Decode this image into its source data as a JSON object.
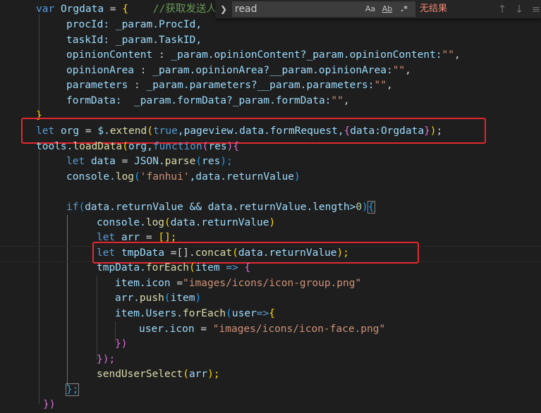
{
  "find": {
    "query": "read",
    "result": "无结果",
    "options": {
      "match_case": "Aa",
      "whole_word": "Ab",
      "regex": ".*"
    }
  },
  "code": {
    "l1": [
      "var",
      "Orgdata",
      "=",
      "{",
      "//获取发送人"
    ],
    "l2": [
      "procId:",
      "_param.ProcId,"
    ],
    "l3": [
      "taskId:",
      "_param.TaskID,"
    ],
    "l4": [
      "opinionContent",
      ":",
      "_param.opinionContent?_param.opinionContent:",
      "\"\"",
      ","
    ],
    "l5": [
      "opinionArea",
      ":",
      "_param.opinionArea?__param.opinionArea:",
      "\"\"",
      ","
    ],
    "l6": [
      "parameters",
      ":",
      "_param.parameters?__param.parameters:",
      "\"\"",
      ","
    ],
    "l7": [
      "formData:",
      "_param.formData?_param.formData:",
      "\"\"",
      ","
    ],
    "l8": [
      "}"
    ],
    "l9": [
      "let",
      "org",
      "=",
      "$.",
      "extend",
      "(",
      "true",
      ",pageview.data.formRequest,",
      "{",
      "data:Orgdata",
      "}",
      ")",
      ";"
    ],
    "l10": [
      "tools.",
      "loadData",
      "(",
      "org,",
      "function",
      "(",
      "res",
      "){"
    ],
    "l11": [
      "let",
      "data",
      "=",
      "JSON.",
      "parse",
      "(",
      "res",
      ");"
    ],
    "l12": [
      "console.",
      "log",
      "(",
      "'fanhui'",
      ",data.returnValue",
      ")"
    ],
    "l13": [
      "if",
      "(",
      "data.returnValue && data.returnValue.length>",
      "0",
      ")",
      "{"
    ],
    "l14": [
      "console.",
      "log",
      "(",
      "data.returnValue",
      ")"
    ],
    "l15": [
      "let",
      "arr",
      "=",
      "[];"
    ],
    "l16": [
      "let",
      "tmpData",
      "=[].",
      "concat",
      "(",
      "data.returnValue",
      ");"
    ],
    "l17": [
      "tmpData.",
      "forEach",
      "(",
      "item",
      "=>",
      "{"
    ],
    "l18": [
      "item.icon",
      "=",
      "\"images/icons/icon-group.png\""
    ],
    "l19": [
      "arr.",
      "push",
      "(",
      "item",
      ")"
    ],
    "l20": [
      "item.Users.",
      "forEach",
      "(",
      "user",
      "=>",
      "{"
    ],
    "l21": [
      "user.icon",
      "=",
      "\"images/icons/icon-face.png\""
    ],
    "l22": [
      "})"
    ],
    "l23": [
      "});"
    ],
    "l24": [
      "sendUserSelect",
      "(",
      "arr",
      ");"
    ],
    "l25": [
      "};"
    ],
    "l26": [
      "})"
    ]
  },
  "colors": {
    "highlight_box": "#e0282e",
    "keyword": "#569cd6",
    "string": "#ce9178"
  }
}
